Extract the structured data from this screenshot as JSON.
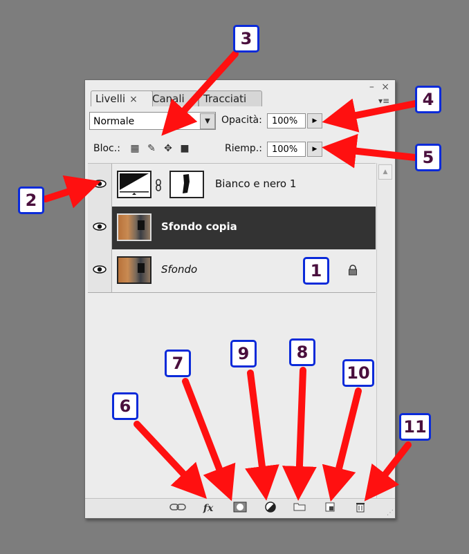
{
  "panel": {
    "tabs": [
      {
        "label": "Livelli",
        "close": "×",
        "active": true
      },
      {
        "label": "Canali",
        "active": false
      },
      {
        "label": "Tracciati",
        "active": false
      }
    ],
    "window_controls": {
      "minimize": "–",
      "close": "×"
    },
    "menu_icon": "panel-menu-icon"
  },
  "blend": {
    "value": "Normale"
  },
  "opacity": {
    "label": "Opacità:",
    "value": "100%"
  },
  "lock": {
    "label": "Bloc.:"
  },
  "fill": {
    "label": "Riemp.:",
    "value": "100%"
  },
  "layers": [
    {
      "name": "Bianco e nero 1",
      "type": "adjustment",
      "visible": true,
      "selected": false
    },
    {
      "name": "Sfondo copia",
      "type": "image",
      "visible": true,
      "selected": true
    },
    {
      "name": "Sfondo",
      "type": "image",
      "visible": true,
      "selected": false,
      "locked": true
    }
  ],
  "bottom_icons": [
    "link-icon",
    "fx-icon",
    "mask-icon",
    "adjustment-icon",
    "folder-icon",
    "new-layer-icon",
    "trash-icon"
  ],
  "bottom_labels": {
    "fx": "fx"
  },
  "callouts": [
    "1",
    "2",
    "3",
    "4",
    "5",
    "6",
    "7",
    "8",
    "9",
    "10",
    "11"
  ],
  "colors": {
    "arrow": "#ff1010",
    "callout_border": "#0a2ad9",
    "selected_layer": "#333333"
  }
}
